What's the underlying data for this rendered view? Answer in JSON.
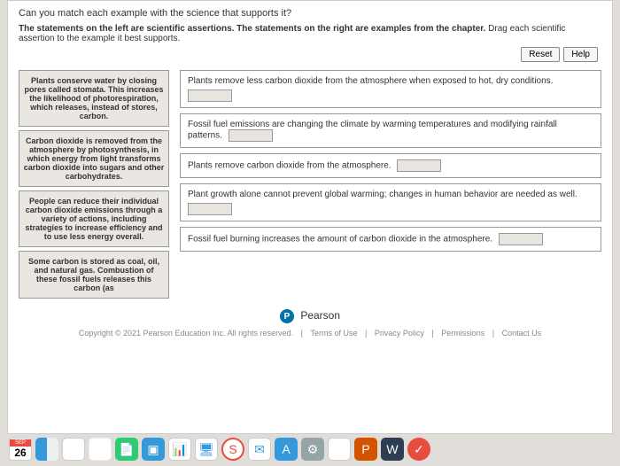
{
  "question": "Can you match each example with the science that supports it?",
  "instructions_prefix": "The statements on the left are scientific assertions. The statements on the right are examples from the chapter.",
  "instructions_action": "Drag each scientific assertion to the example it best supports.",
  "buttons": {
    "reset": "Reset",
    "help": "Help"
  },
  "assertions": [
    "Plants conserve water by closing pores called stomata. This increases the likelihood of photorespiration, which releases, instead of stores, carbon.",
    "Carbon dioxide is removed from the atmosphere by photosynthesis, in which energy from light transforms carbon dioxide into sugars and other carbohydrates.",
    "People can reduce their individual carbon dioxide emissions through a variety of actions, including strategies to increase efficiency and to use less energy overall.",
    "Some carbon is stored as coal, oil, and natural gas. Combustion of these fossil fuels releases this carbon (as"
  ],
  "targets": [
    {
      "text": "Plants remove less carbon dioxide from the atmosphere when exposed to hot, dry conditions.",
      "slot_below": true
    },
    {
      "text": "Fossil fuel emissions are changing the climate by warming temperatures and modifying rainfall patterns.",
      "slot_below": false
    },
    {
      "text": "Plants remove carbon dioxide from the atmosphere.",
      "slot_below": false
    },
    {
      "text": "Plant growth alone cannot prevent global warming; changes in human behavior are needed as well.",
      "slot_below": true
    },
    {
      "text": "Fossil fuel burning increases the amount of carbon dioxide in the atmosphere.",
      "slot_below": false
    }
  ],
  "brand": "Pearson",
  "copyright": "Copyright © 2021 Pearson Education Inc. All rights reserved.",
  "footer_links": [
    "Terms of Use",
    "Privacy Policy",
    "Permissions",
    "Contact Us"
  ],
  "calendar": {
    "month": "SEP",
    "day": "26"
  }
}
